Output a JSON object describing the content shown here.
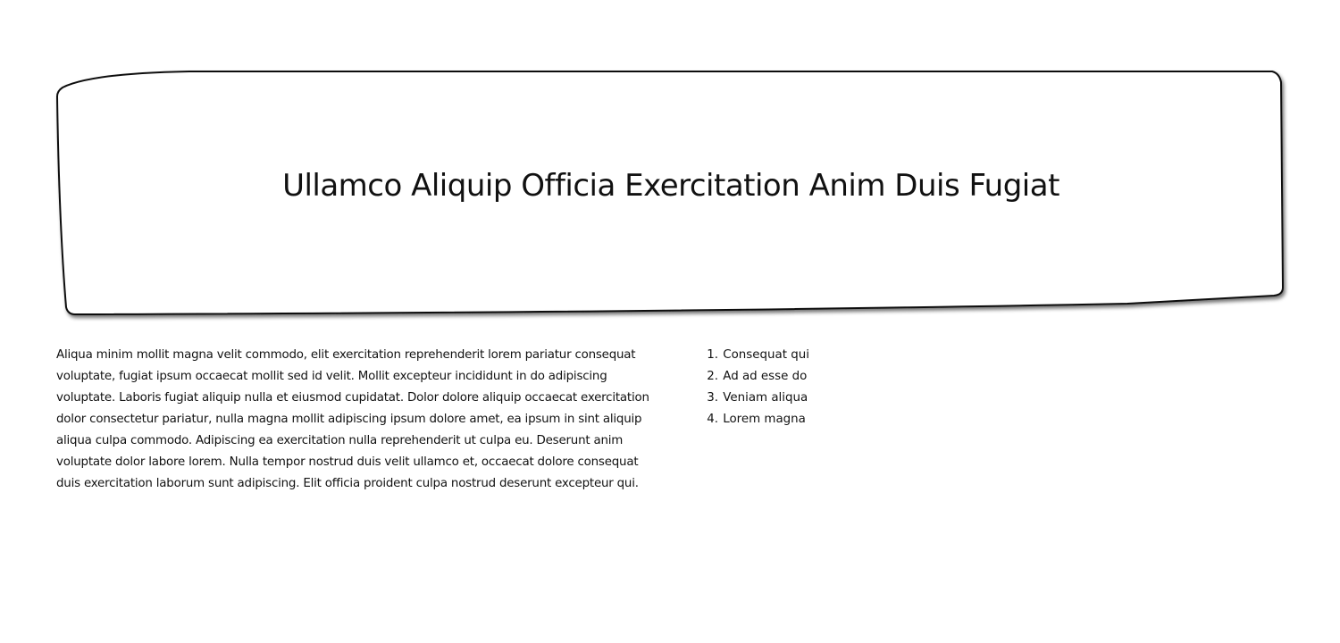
{
  "hero": {
    "title": "Ullamco Aliquip Officia Exercitation Anim Duis Fugiat"
  },
  "content": {
    "paragraph": "Aliqua minim mollit magna velit commodo, elit exercitation reprehenderit lorem pariatur consequat voluptate, fugiat ipsum occaecat mollit sed id velit. Mollit excepteur incididunt in do adipiscing voluptate. Laboris fugiat aliquip nulla et eiusmod cupidatat. Dolor dolore aliquip occaecat exercitation dolor consectetur pariatur, nulla magna mollit adipiscing ipsum dolore amet, ea ipsum in sint aliquip aliqua culpa commodo. Adipiscing ea exercitation nulla reprehenderit ut culpa eu. Deserunt anim voluptate dolor labore lorem. Nulla tempor nostrud duis velit ullamco et, occaecat dolore consequat duis exercitation laborum sunt adipiscing. Elit officia proident culpa nostrud deserunt excepteur qui."
  },
  "list": {
    "items": [
      {
        "number": "1.",
        "label": "Consequat qui"
      },
      {
        "number": "2.",
        "label": "Ad ad esse do"
      },
      {
        "number": "3.",
        "label": "Veniam aliqua"
      },
      {
        "number": "4.",
        "label": "Lorem magna"
      }
    ]
  }
}
